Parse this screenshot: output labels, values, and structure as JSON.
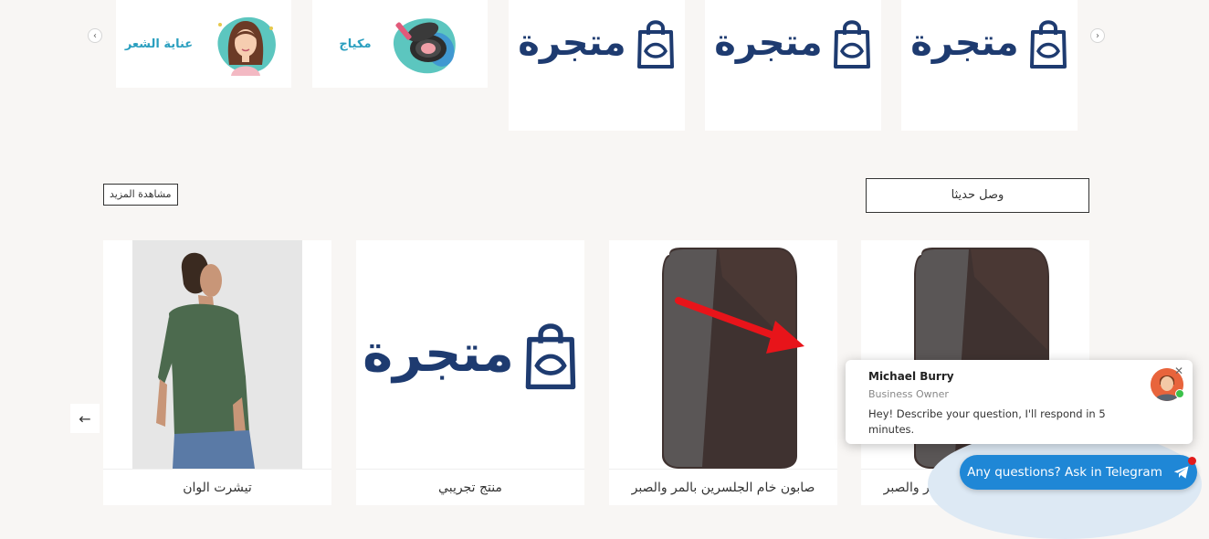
{
  "categories": {
    "items": [
      {
        "type": "image",
        "label": "عناية الشعر",
        "icon": "woman-hair-icon"
      },
      {
        "type": "image",
        "label": "مكياج",
        "icon": "makeup-compact-icon"
      },
      {
        "type": "logo",
        "label": "متجرة",
        "icon": "shopping-bag-icon"
      },
      {
        "type": "logo",
        "label": "متجرة",
        "icon": "shopping-bag-icon"
      },
      {
        "type": "logo",
        "label": "متجرة",
        "icon": "shopping-bag-icon"
      }
    ],
    "prev_icon": "chevron-left-icon",
    "next_icon": "chevron-right-icon"
  },
  "section": {
    "title": "وصل حديثا",
    "more_label": "مشاهدة المزيد"
  },
  "products": [
    {
      "name": "تيشرت الوان",
      "image": "man-green-tshirt"
    },
    {
      "name": "منتج تجريبي",
      "image": "store-logo",
      "logo_text": "متجرة"
    },
    {
      "name": "صابون خام الجلسرين بالمر والصبر",
      "image": "dark-soap-bar"
    },
    {
      "name": "صابون خام الجلسرين بالمر والصبر",
      "image": "dark-soap-bar"
    }
  ],
  "nav": {
    "prev_icon": "arrow-left-icon"
  },
  "chat": {
    "name": "Michael Burry",
    "role": "Business Owner",
    "message": "Hey! Describe your question, I'll respond in 5 minutes.",
    "close_icon": "close-icon",
    "telegram_label": "Any questions? Ask in Telegram",
    "telegram_icon": "telegram-plane-icon"
  },
  "colors": {
    "brand": "#1e3b70",
    "accent": "#2a9fbf",
    "telegram": "#1f87d6",
    "annotation_arrow": "#e8141a"
  }
}
